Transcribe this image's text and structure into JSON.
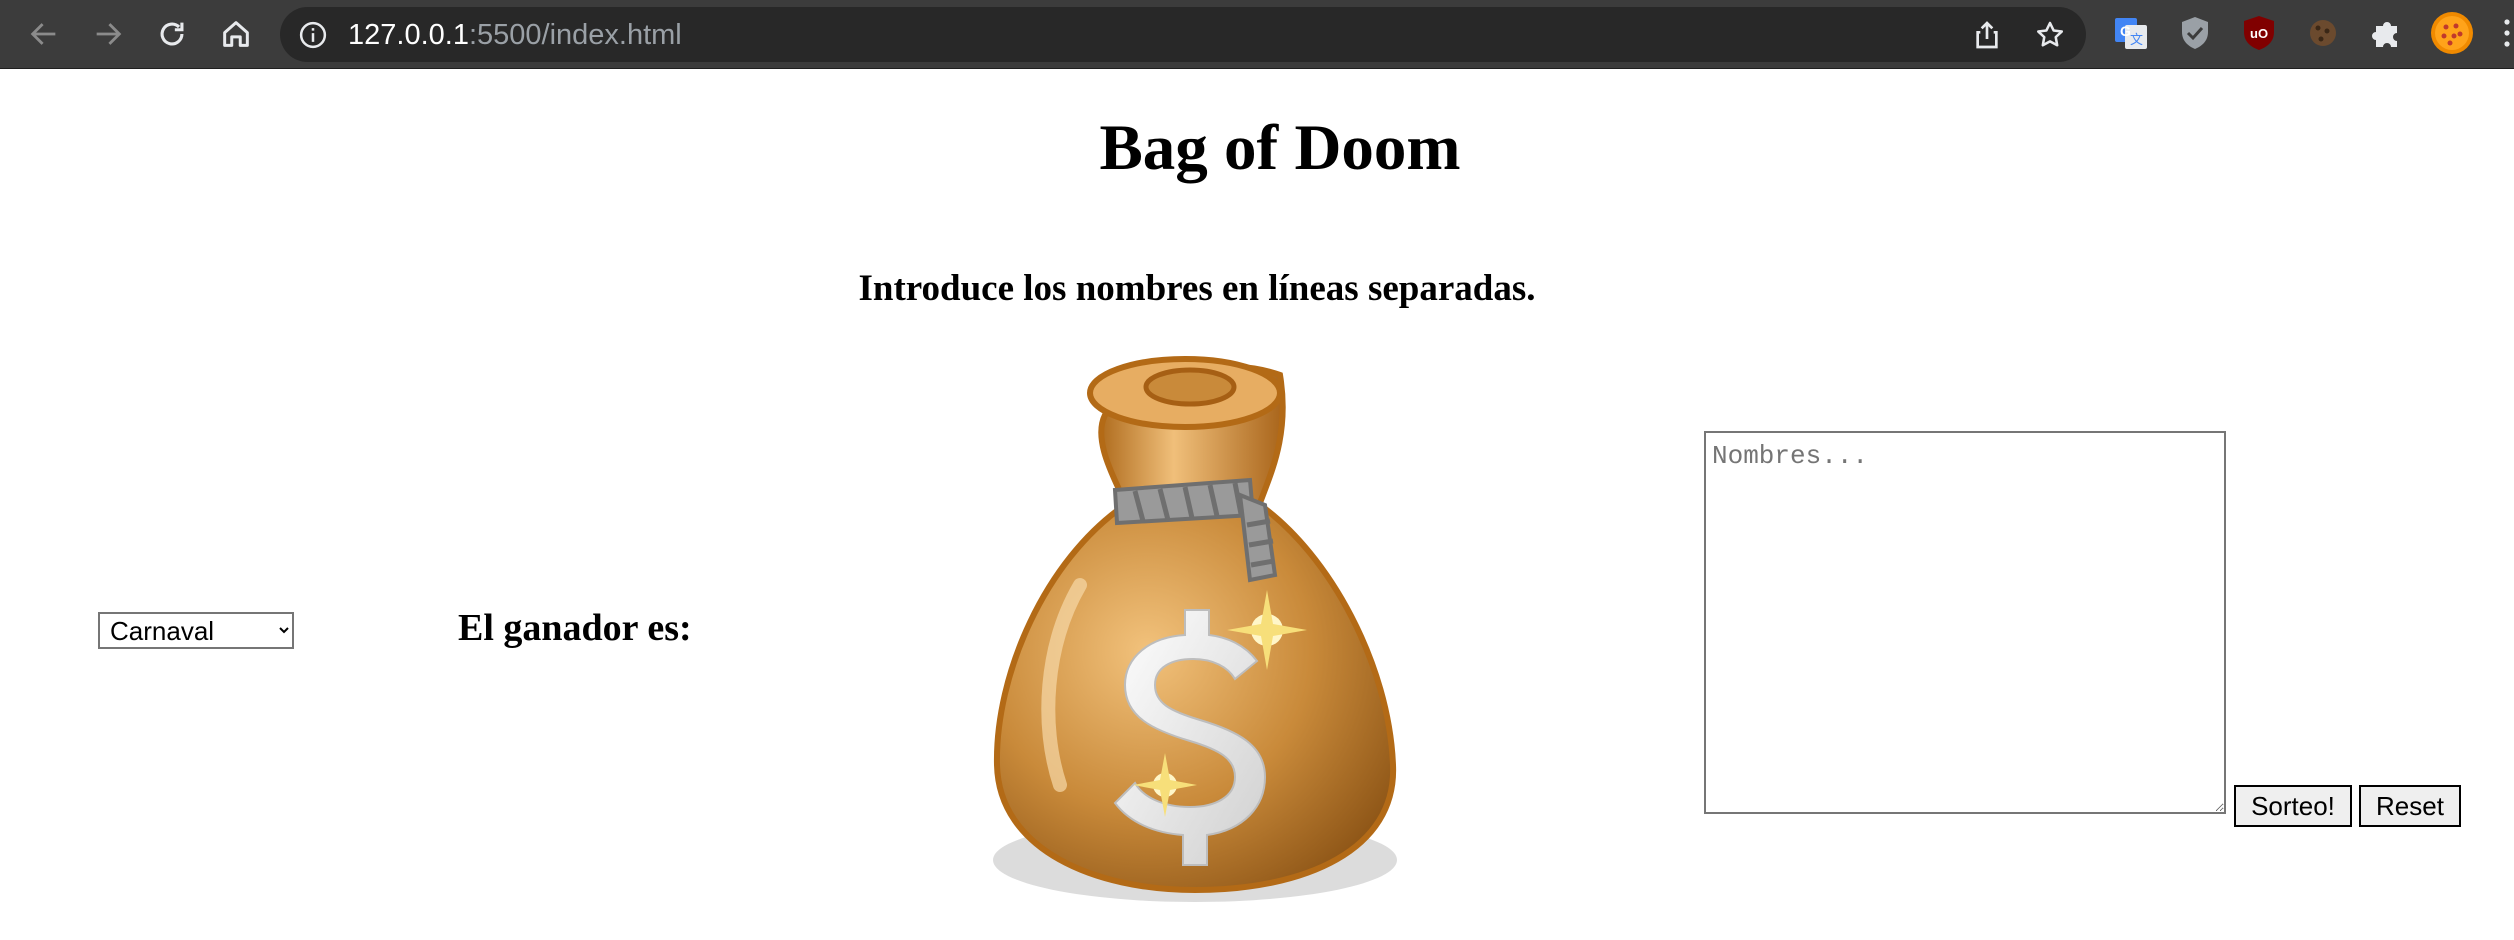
{
  "browser": {
    "url_host": "127.0.0.1",
    "url_path": ":5500/index.html",
    "toolbar_icons": [
      "back-icon",
      "forward-icon",
      "reload-icon",
      "home-icon",
      "info-icon",
      "share-icon",
      "star-icon"
    ],
    "extensions": [
      "google-translate-icon",
      "shield-check-icon",
      "ublock-origin-icon",
      "cookie-icon",
      "puzzle-icon",
      "profile-avatar-icon"
    ]
  },
  "page": {
    "title": "Bag of Doom",
    "instructions": "Introduce los nombres en líneas separadas.",
    "select": {
      "value": "Carnaval",
      "options": [
        "Carnaval"
      ]
    },
    "winner_label": "El ganador es:",
    "names_placeholder": "Nombres...",
    "draw_button": "Sorteo!",
    "reset_button": "Reset",
    "image": "money-bag-icon"
  },
  "colors": {
    "chrome_bg": "#3c3c3c",
    "omnibox_bg": "#282828",
    "bag_main": "#c07a25",
    "bag_light": "#e9ad5f",
    "rope": "#9a9a9a"
  }
}
